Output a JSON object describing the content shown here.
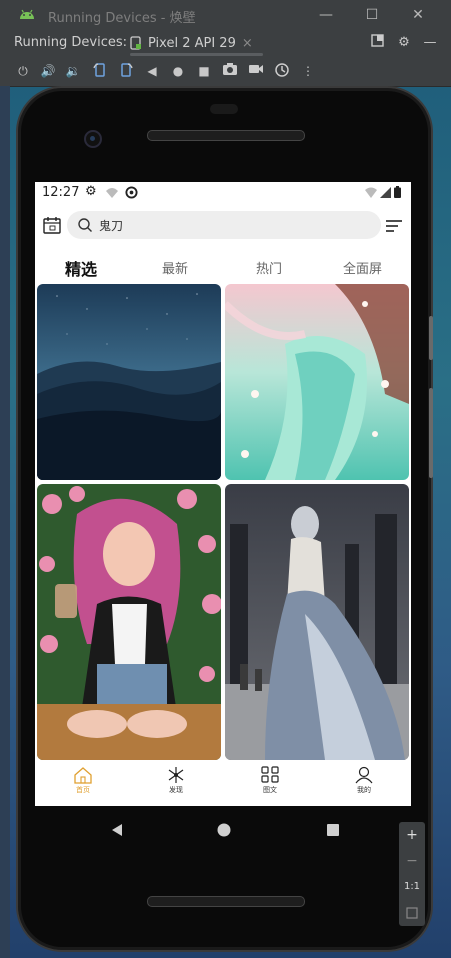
{
  "window": {
    "title": "Running Devices - 焕壁",
    "minimize": "—",
    "maximize": "☐",
    "close": "✕"
  },
  "device_bar": {
    "label": "Running Devices:",
    "device_tab": "Pixel 2 API 29",
    "tab_close": "×"
  },
  "toolbar_icons": [
    "power-icon",
    "volume-up-icon",
    "volume-down-icon",
    "rotate-left-icon",
    "rotate-right-icon",
    "back-icon",
    "home-icon",
    "overview-icon",
    "screenshot-icon",
    "screenrecord-icon",
    "snapshot-icon",
    "more-icon"
  ],
  "status": {
    "time": "12:27"
  },
  "search": {
    "value": "鬼刀"
  },
  "tabs": [
    "精选",
    "最新",
    "热门",
    "全面屏"
  ],
  "active_tab": 0,
  "nav": [
    {
      "label": "首页",
      "icon": "home-icon"
    },
    {
      "label": "发现",
      "icon": "discover-icon"
    },
    {
      "label": "图文",
      "icon": "grid-icon"
    },
    {
      "label": "我的",
      "icon": "profile-icon"
    }
  ],
  "active_nav": 0,
  "zoom": {
    "zoom_in": "+",
    "zoom_out": "−",
    "actual": "1:1"
  },
  "colors": {
    "accent": "#e0a030",
    "ide_bg": "#3c3f41"
  }
}
